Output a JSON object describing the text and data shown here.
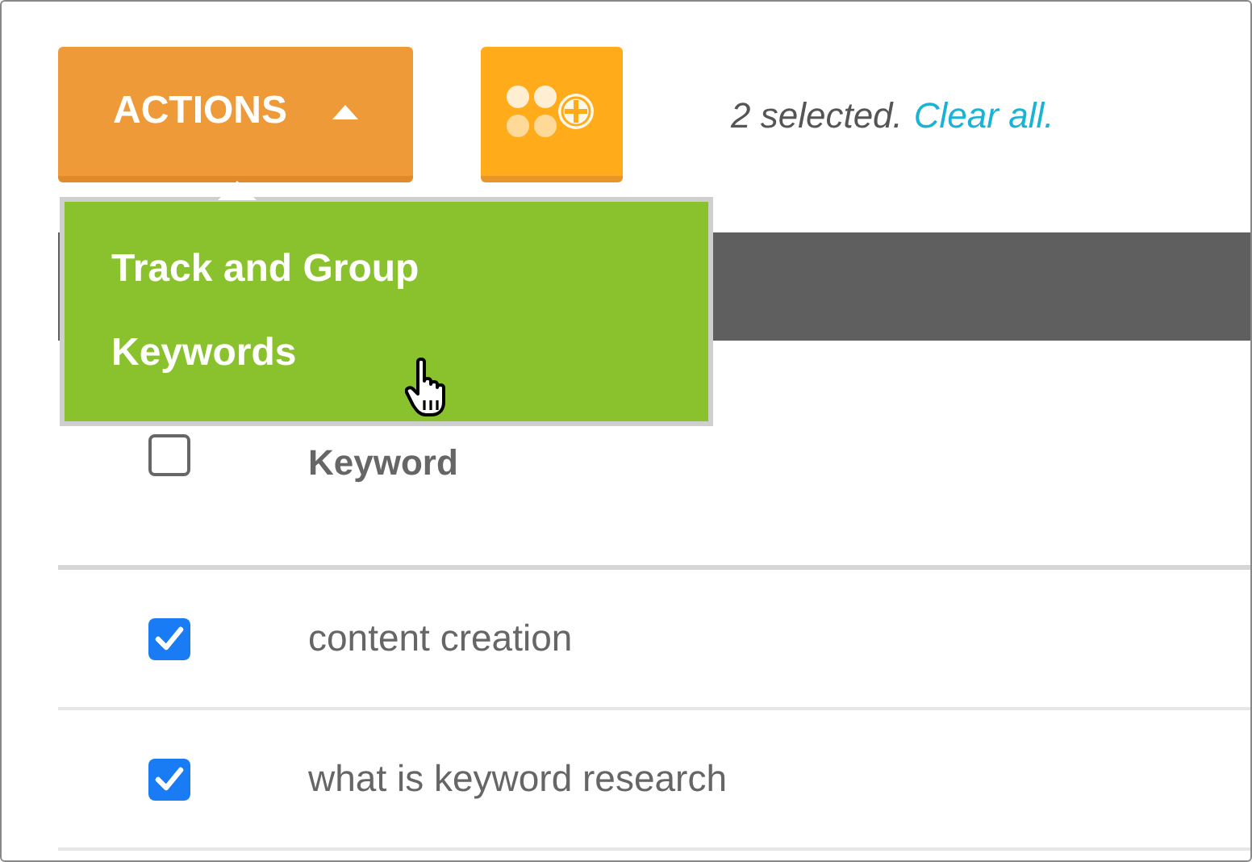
{
  "toolbar": {
    "actions_button": {
      "label": "ACTIONS",
      "expanded": true
    },
    "selection_text": "2 selected.",
    "clear_link": "Clear all."
  },
  "actions_menu": {
    "items": [
      {
        "label": "Track and Group",
        "hovered": false
      },
      {
        "label": "Keywords",
        "hovered": true
      }
    ]
  },
  "table": {
    "select_all": {
      "checked": false
    },
    "columns": [
      "Keyword"
    ],
    "rows": [
      {
        "checked": true,
        "keyword": "content creation"
      },
      {
        "checked": true,
        "keyword": "what is keyword research"
      }
    ]
  }
}
